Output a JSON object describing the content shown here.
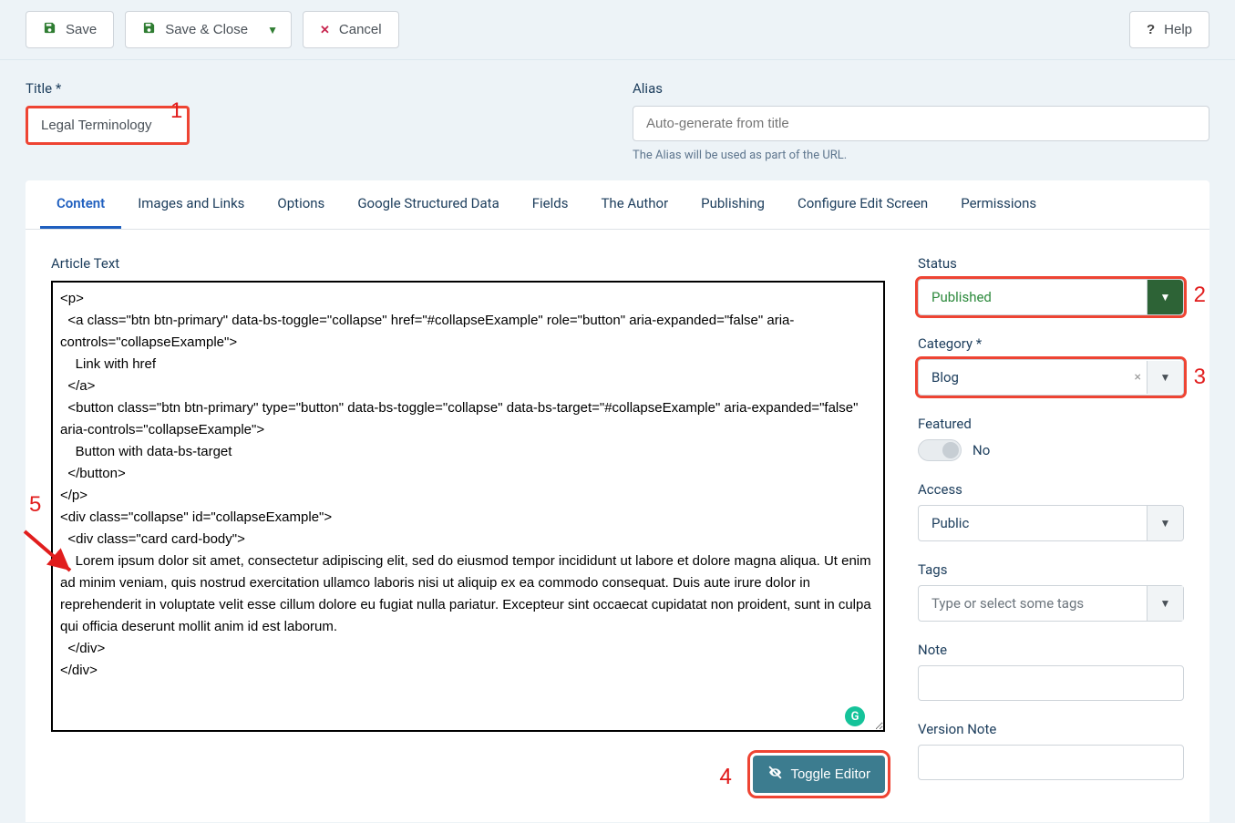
{
  "toolbar": {
    "save": "Save",
    "saveClose": "Save & Close",
    "cancel": "Cancel",
    "help": "Help"
  },
  "title": {
    "label": "Title *",
    "value": "Legal Terminology"
  },
  "alias": {
    "label": "Alias",
    "placeholder": "Auto-generate from title",
    "help": "The Alias will be used as part of the URL."
  },
  "tabs": [
    "Content",
    "Images and Links",
    "Options",
    "Google Structured Data",
    "Fields",
    "The Author",
    "Publishing",
    "Configure Edit Screen",
    "Permissions"
  ],
  "activeTabIndex": 0,
  "editor": {
    "label": "Article Text",
    "text": "<p>\n  <a class=\"btn btn-primary\" data-bs-toggle=\"collapse\" href=\"#collapseExample\" role=\"button\" aria-expanded=\"false\" aria-controls=\"collapseExample\">\n    Link with href\n  </a>\n  <button class=\"btn btn-primary\" type=\"button\" data-bs-toggle=\"collapse\" data-bs-target=\"#collapseExample\" aria-expanded=\"false\" aria-controls=\"collapseExample\">\n    Button with data-bs-target\n  </button>\n</p>\n<div class=\"collapse\" id=\"collapseExample\">\n  <div class=\"card card-body\">\n    Lorem ipsum dolor sit amet, consectetur adipiscing elit, sed do eiusmod tempor incididunt ut labore et dolore magna aliqua. Ut enim ad minim veniam, quis nostrud exercitation ullamco laboris nisi ut aliquip ex ea commodo consequat. Duis aute irure dolor in reprehenderit in voluptate velit esse cillum dolore eu fugiat nulla pariatur. Excepteur sint occaecat cupidatat non proident, sunt in culpa qui officia deserunt mollit anim id est laborum.\n  </div>\n</div>",
    "toggle": "Toggle Editor"
  },
  "sidebar": {
    "status": {
      "label": "Status",
      "value": "Published"
    },
    "category": {
      "label": "Category *",
      "value": "Blog"
    },
    "featured": {
      "label": "Featured",
      "value": "No"
    },
    "access": {
      "label": "Access",
      "value": "Public"
    },
    "tags": {
      "label": "Tags",
      "placeholder": "Type or select some tags"
    },
    "note": {
      "label": "Note"
    },
    "versionNote": {
      "label": "Version Note"
    }
  },
  "annotations": {
    "n1": "1",
    "n2": "2",
    "n3": "3",
    "n4": "4",
    "n5": "5"
  }
}
